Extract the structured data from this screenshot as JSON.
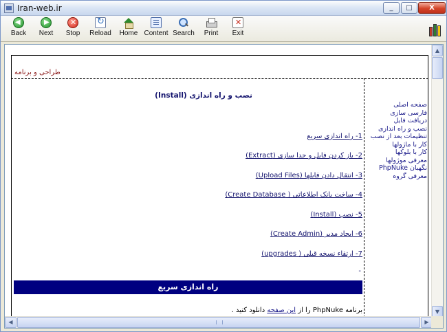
{
  "window": {
    "title": "Iran-web.ir",
    "minimize_label": "_",
    "maximize_label": "□",
    "close_label": "X"
  },
  "toolbar": {
    "buttons": [
      {
        "label": "Back",
        "icon": "back-arrow-icon"
      },
      {
        "label": "Next",
        "icon": "next-arrow-icon"
      },
      {
        "label": "Stop",
        "icon": "stop-icon"
      },
      {
        "label": "Reload",
        "icon": "reload-icon"
      },
      {
        "label": "Home",
        "icon": "home-icon"
      },
      {
        "label": "Content",
        "icon": "content-icon"
      },
      {
        "label": "Search",
        "icon": "search-icon"
      },
      {
        "label": "Print",
        "icon": "print-icon"
      },
      {
        "label": "Exit",
        "icon": "exit-icon"
      }
    ],
    "right_icon": "books-icon"
  },
  "page": {
    "header_text": "طراحی و برنامه",
    "main_title": "نصب و راه اندازی (Install)",
    "toc": [
      {
        "label": "1- راه اندازی سریع"
      },
      {
        "label": "2- باز کردن فایل و جدا سازی (Extract)"
      },
      {
        "label": "3- انتقال دادن فایلها (Upload Files)"
      },
      {
        "label": "4- ساخت بانک اطلاعاتی ( Create Database)"
      },
      {
        "label": "5- نصب (Install)"
      },
      {
        "label": "6- ایجاد مدیر (Create Admin)"
      },
      {
        "label": "7- ارتقاء نسخه قبلی ( upgrades)"
      }
    ],
    "dash": "-",
    "section_heading": "راه اندازی سریع",
    "paragraph": {
      "before": "برنامه PhpNuke را از ",
      "link": "این صفحه",
      "after": " دانلود کنید ."
    }
  },
  "sidebar": {
    "items": [
      {
        "label": "صفحه اصلی"
      },
      {
        "label": "فارسی سازی"
      },
      {
        "label": "دریافت فایل"
      },
      {
        "label": "نصب و راه اندازی"
      },
      {
        "label": "تنظیمات بعد از نصب"
      },
      {
        "label": "کار با ماژولها"
      },
      {
        "label": "کار با بلوکها"
      },
      {
        "label": "معرفی موژولها"
      },
      {
        "label": "نگهبان PhpNuke"
      },
      {
        "label": "معرفی گروه"
      }
    ]
  },
  "scrollbars": {
    "up": "▲",
    "down": "▼",
    "left": "◀",
    "right": "▶"
  },
  "colors": {
    "section_bar": "#000080",
    "link": "#1a1a8a",
    "header_text": "#8b1a1a"
  }
}
